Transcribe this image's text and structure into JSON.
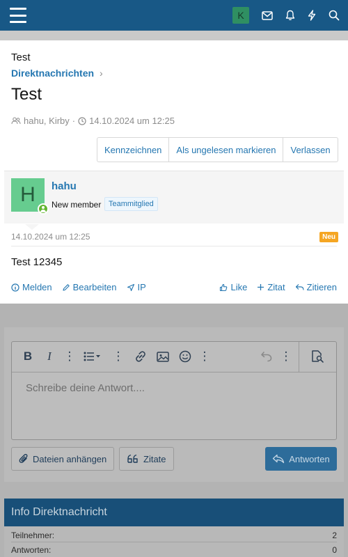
{
  "topbar": {
    "avatar_letter": "K",
    "icons": [
      "menu-icon",
      "envelope-icon",
      "bell-icon",
      "bolt-icon",
      "search-icon"
    ],
    "color": "#185886"
  },
  "breadcrumb": {
    "title": "Test",
    "link": "Direktnachrichten",
    "chevron": "›"
  },
  "conversation": {
    "title": "Test",
    "participants": "hahu, Kirby",
    "separator": "·",
    "date": "14.10.2024 um 12:25"
  },
  "actions": {
    "report": "Kennzeichnen",
    "mark_unread": "Als ungelesen markieren",
    "leave": "Verlassen"
  },
  "message": {
    "avatar_letter": "H",
    "username": "hahu",
    "user_title": "New member",
    "badge": "Teammitglied",
    "date": "14.10.2024 um 12:25",
    "new_label": "Neu",
    "body": "Test 12345",
    "links_left": [
      "Melden",
      "Bearbeiten",
      "IP"
    ],
    "links_right": [
      "Like",
      "Zitat",
      "Zitieren"
    ]
  },
  "editor": {
    "placeholder": "Schreibe deine Antwort...."
  },
  "buttons": {
    "attach": "Dateien anhängen",
    "quotes": "Zitate",
    "reply": "Antworten"
  },
  "info": {
    "title": "Info Direktnachricht",
    "rows": [
      {
        "label": "Teilnehmer:",
        "value": "2"
      },
      {
        "label": "Antworten:",
        "value": "0"
      }
    ]
  },
  "colors": {
    "accent": "#2577b1",
    "header": "#185886",
    "new_badge": "#f5a623",
    "online": "#63b530"
  }
}
